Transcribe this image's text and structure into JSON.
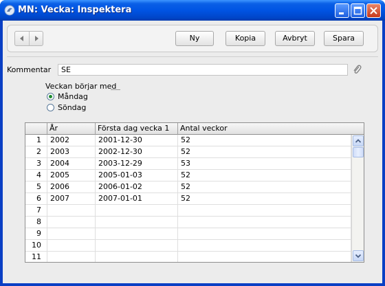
{
  "window": {
    "title": "MN: Vecka: Inspektera",
    "title_color": "#0054e3"
  },
  "toolbar": {
    "buttons": [
      {
        "label": "Ny"
      },
      {
        "label": "Kopia"
      },
      {
        "label": "Avbryt"
      },
      {
        "label": "Spara"
      }
    ]
  },
  "form": {
    "comment_label": "Kommentar",
    "comment_value": "SE",
    "week_start_label": "Veckan börjar med",
    "options": [
      {
        "label": "Måndag",
        "selected": true
      },
      {
        "label": "Söndag",
        "selected": false
      }
    ]
  },
  "grid": {
    "columns": [
      "",
      "År",
      "Första dag vecka 1",
      "Antal veckor"
    ],
    "rows": [
      {
        "num": "1",
        "year": "2002",
        "first_day": "2001-12-30",
        "weeks": "52"
      },
      {
        "num": "2",
        "year": "2003",
        "first_day": "2002-12-30",
        "weeks": "52"
      },
      {
        "num": "3",
        "year": "2004",
        "first_day": "2003-12-29",
        "weeks": "53"
      },
      {
        "num": "4",
        "year": "2005",
        "first_day": "2005-01-03",
        "weeks": "52"
      },
      {
        "num": "5",
        "year": "2006",
        "first_day": "2006-01-02",
        "weeks": "52"
      },
      {
        "num": "6",
        "year": "2007",
        "first_day": "2007-01-01",
        "weeks": "52"
      },
      {
        "num": "7",
        "year": "",
        "first_day": "",
        "weeks": ""
      },
      {
        "num": "8",
        "year": "",
        "first_day": "",
        "weeks": ""
      },
      {
        "num": "9",
        "year": "",
        "first_day": "",
        "weeks": ""
      },
      {
        "num": "10",
        "year": "",
        "first_day": "",
        "weeks": ""
      },
      {
        "num": "11",
        "year": "",
        "first_day": "",
        "weeks": ""
      }
    ]
  },
  "icons": {
    "app": "app-icon",
    "minimize": "minimize-icon",
    "maximize": "maximize-icon",
    "close": "close-icon",
    "prev": "arrow-left-icon",
    "next": "arrow-right-icon",
    "attachment": "paperclip-icon",
    "scroll_up": "chevron-up-icon",
    "scroll_down": "chevron-down-icon"
  }
}
